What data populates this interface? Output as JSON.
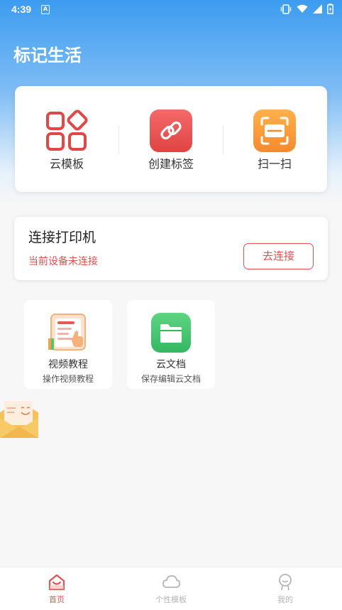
{
  "status_bar": {
    "time": "4:39"
  },
  "header": {
    "title": "标记生活"
  },
  "quick_actions": [
    {
      "label": "云模板",
      "icon": "grid-template-icon"
    },
    {
      "label": "创建标签",
      "icon": "link-icon"
    },
    {
      "label": "扫一扫",
      "icon": "scan-icon"
    }
  ],
  "printer": {
    "title": "连接打印机",
    "status": "当前设备未连接",
    "connect_label": "去连接"
  },
  "tiles": [
    {
      "title": "视频教程",
      "subtitle": "操作视频教程",
      "icon": "video-tutorial-icon"
    },
    {
      "title": "云文档",
      "subtitle": "保存编辑云文档",
      "icon": "folder-icon"
    }
  ],
  "bottom_nav": [
    {
      "label": "首页",
      "icon": "home-icon",
      "active": true
    },
    {
      "label": "个性模板",
      "icon": "cloud-icon",
      "active": false
    },
    {
      "label": "我的",
      "icon": "profile-icon",
      "active": false
    }
  ],
  "colors": {
    "header_blue": "#3d9cf0",
    "accent_red": "#e05252",
    "active_nav": "#e05252",
    "inactive_nav": "#b5b5b5"
  }
}
